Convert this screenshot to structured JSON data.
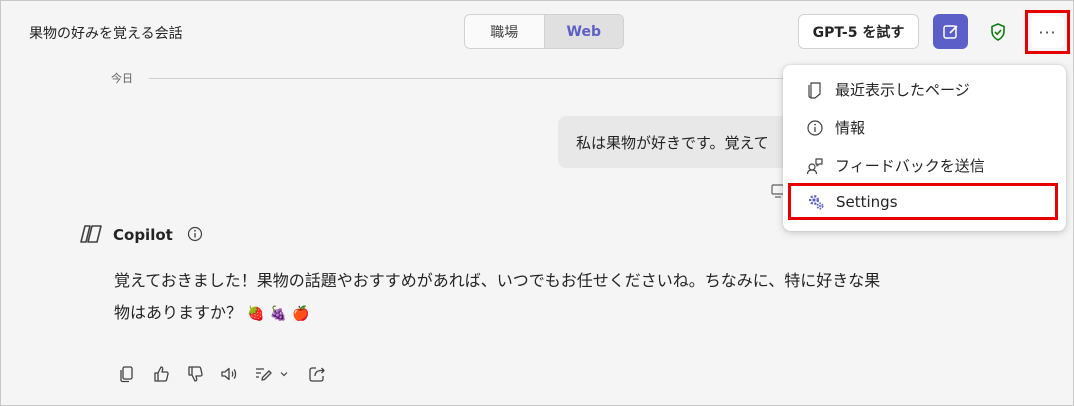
{
  "header": {
    "title": "果物の好みを覚える会話",
    "segment": {
      "options": [
        "職場",
        "Web"
      ],
      "active": "Web"
    },
    "try_button": "GPT-5 を試す",
    "icons": [
      "compose-icon",
      "shield-check-icon",
      "more-icon"
    ],
    "more_label": "···"
  },
  "conversation": {
    "date_label": "今日",
    "user_message": "私は果物が好きです。覚えて",
    "assistant": {
      "name": "Copilot",
      "reply_line1": "覚えておきました！果物の話題やおすすめがあれば、いつでもお任せくださいね。ちなみに、特に好きな果",
      "reply_line2": "物はありますか？",
      "emojis": [
        "🍓",
        "🍇",
        "🍎"
      ],
      "actions": [
        "copy-icon",
        "thumbs-up-icon",
        "thumbs-down-icon",
        "speaker-icon",
        "edit-icon",
        "chevron-down-icon",
        "share-icon"
      ]
    }
  },
  "menu": {
    "items": [
      {
        "label": "最近表示したページ",
        "icon": "pages-icon"
      },
      {
        "label": "情報",
        "icon": "info-icon"
      },
      {
        "label": "フィードバックを送信",
        "icon": "feedback-icon"
      },
      {
        "label": "Settings",
        "icon": "settings-icon",
        "highlighted": true
      }
    ]
  },
  "colors": {
    "accent": "#5b5fc7",
    "highlight_border": "#e60000",
    "shield": "#107c10"
  }
}
